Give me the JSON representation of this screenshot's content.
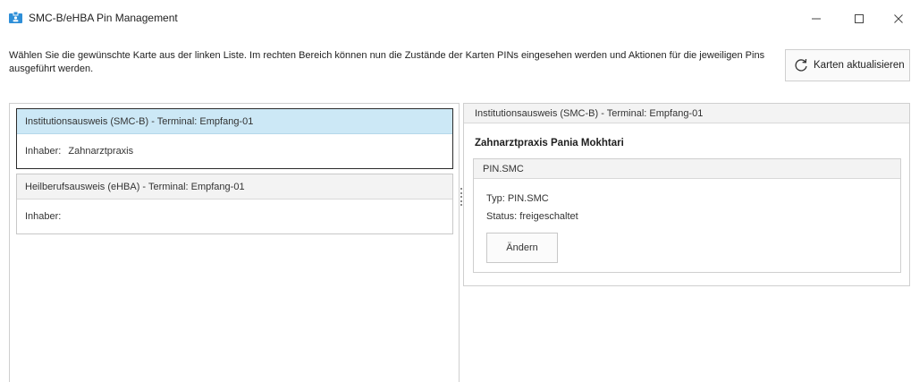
{
  "window": {
    "title": "SMC-B/eHBA Pin Management",
    "minimize_glyph": "—",
    "maximize_glyph": "☐",
    "close_glyph": "✕"
  },
  "header": {
    "description": "Wählen Sie die gewünschte Karte aus der linken Liste. Im rechten Bereich können nun die Zustände der Karten PINs eingesehen werden und Aktionen für die jeweiligen Pins ausgeführt werden.",
    "refresh_label": "Karten aktualisieren",
    "refresh_icon": "refresh-icon"
  },
  "cards": [
    {
      "title": "Institutionsausweis (SMC-B) - Terminal: Empfang-01",
      "owner_label": "Inhaber:",
      "owner_value": "Zahnarztpraxis",
      "selected": true
    },
    {
      "title": "Heilberufsausweis (eHBA) - Terminal: Empfang-01",
      "owner_label": "Inhaber:",
      "owner_value": "",
      "selected": false
    }
  ],
  "detail": {
    "header": "Institutionsausweis (SMC-B) - Terminal: Empfang-01",
    "owner": "Zahnarztpraxis Pania Mokhtari",
    "pin": {
      "name": "PIN.SMC",
      "type_text": "Typ: PIN.SMC",
      "status_text": "Status: freigeschaltet",
      "change_label": "Ändern"
    }
  },
  "colors": {
    "selected_card_header": "#cce8f6",
    "app_icon": "#2e8fd8"
  }
}
